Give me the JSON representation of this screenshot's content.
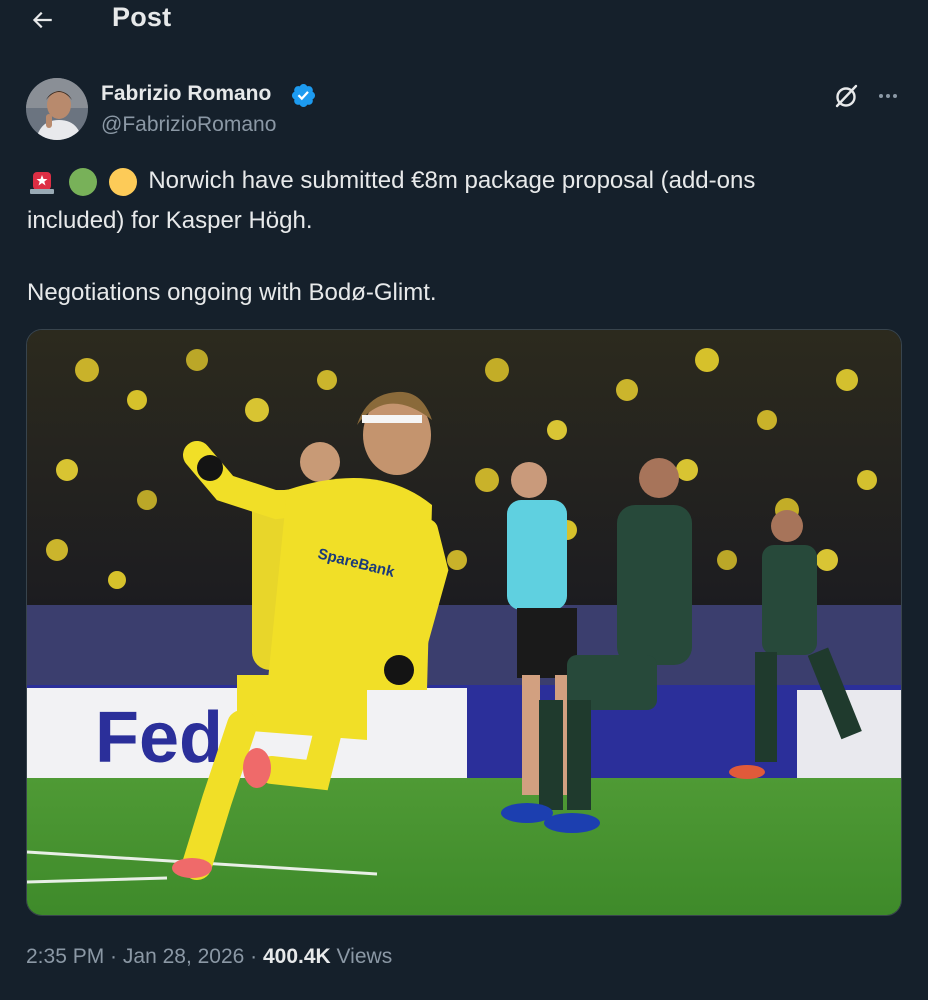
{
  "header": {
    "title": "Post",
    "back_icon": "arrow-left-icon"
  },
  "author": {
    "name": "Fabrizio Romano",
    "handle": "@FabrizioRomano",
    "verified_icon": "verified-badge-icon",
    "verified_color": "#1d9bf0"
  },
  "actions": {
    "grok_icon": "grok-icon",
    "more_icon": "more-dots-icon"
  },
  "tweet": {
    "emojis": [
      "siren-emoji",
      "green-circle-emoji",
      "yellow-circle-emoji"
    ],
    "line1": "Norwich have submitted €8m package proposal (add-ons",
    "line2": "included) for Kasper Högh.",
    "line3": "Negotiations ongoing with Bodø-Glimt."
  },
  "media": {
    "type": "photo",
    "shirt_sponsor": "SpareBank",
    "board_text": "Fed"
  },
  "meta": {
    "time": "2:35 PM",
    "sep1": " · ",
    "date": "Jan 28, 2026",
    "sep2": " · ",
    "views_count": "400.4K",
    "views_label": " Views"
  },
  "colors": {
    "background": "#15202b",
    "text_primary": "#e7e9ea",
    "text_secondary": "#8b98a5",
    "accent": "#1d9bf0"
  }
}
